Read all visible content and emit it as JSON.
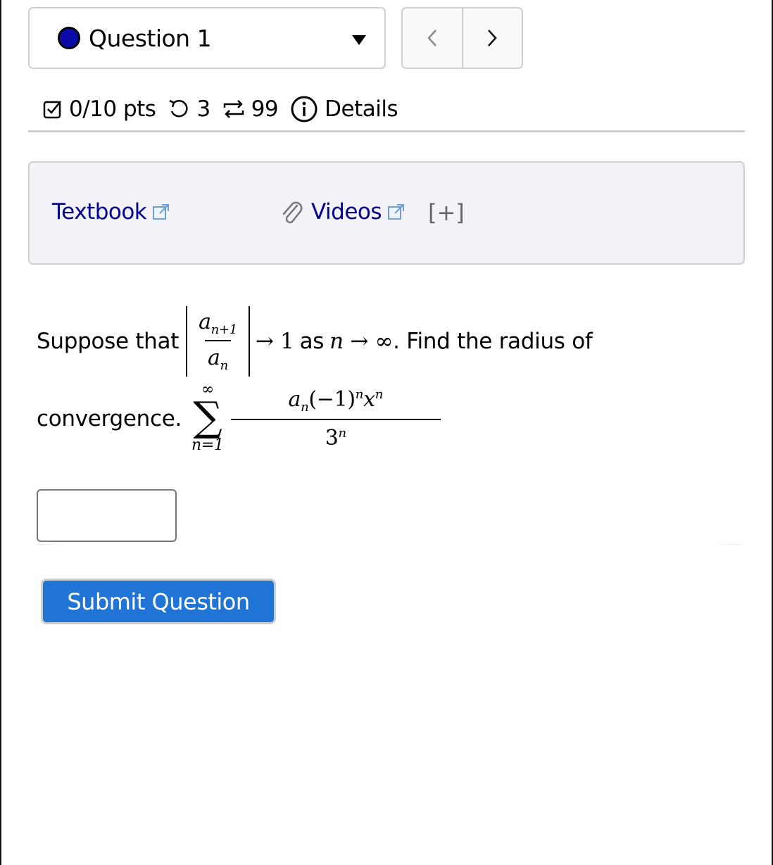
{
  "question_nav": {
    "selected_question": "Question 1",
    "status_dot_color": "#0a0aa6",
    "prev_label": "<",
    "next_label": ">"
  },
  "meta": {
    "score": "0/10 pts",
    "attempts_remaining": "3",
    "versions": "99",
    "details_label": "Details",
    "icons": [
      "checkbox-icon",
      "retry-icon",
      "swap-icon",
      "info-icon"
    ]
  },
  "resources": {
    "textbook_label": "Textbook",
    "videos_label": "Videos",
    "expand_label": "[+]",
    "link_color": "#00008b"
  },
  "question": {
    "intro": "Suppose that",
    "ratio_numerator": "a_{n+1}",
    "ratio_denominator": "a_n",
    "arrow_one": "→ 1",
    "as_text": "as",
    "limit": "n → ∞",
    "period_find": ". Find the radius of",
    "convergence": "convergence.",
    "sum_upper": "∞",
    "sum_lower": "n=1",
    "series_denominator_base": "3",
    "series_denominator_exp": "n"
  },
  "answer": {
    "value": "",
    "placeholder": ""
  },
  "submit": {
    "label": "Submit Question",
    "color": "#1f74d6"
  }
}
